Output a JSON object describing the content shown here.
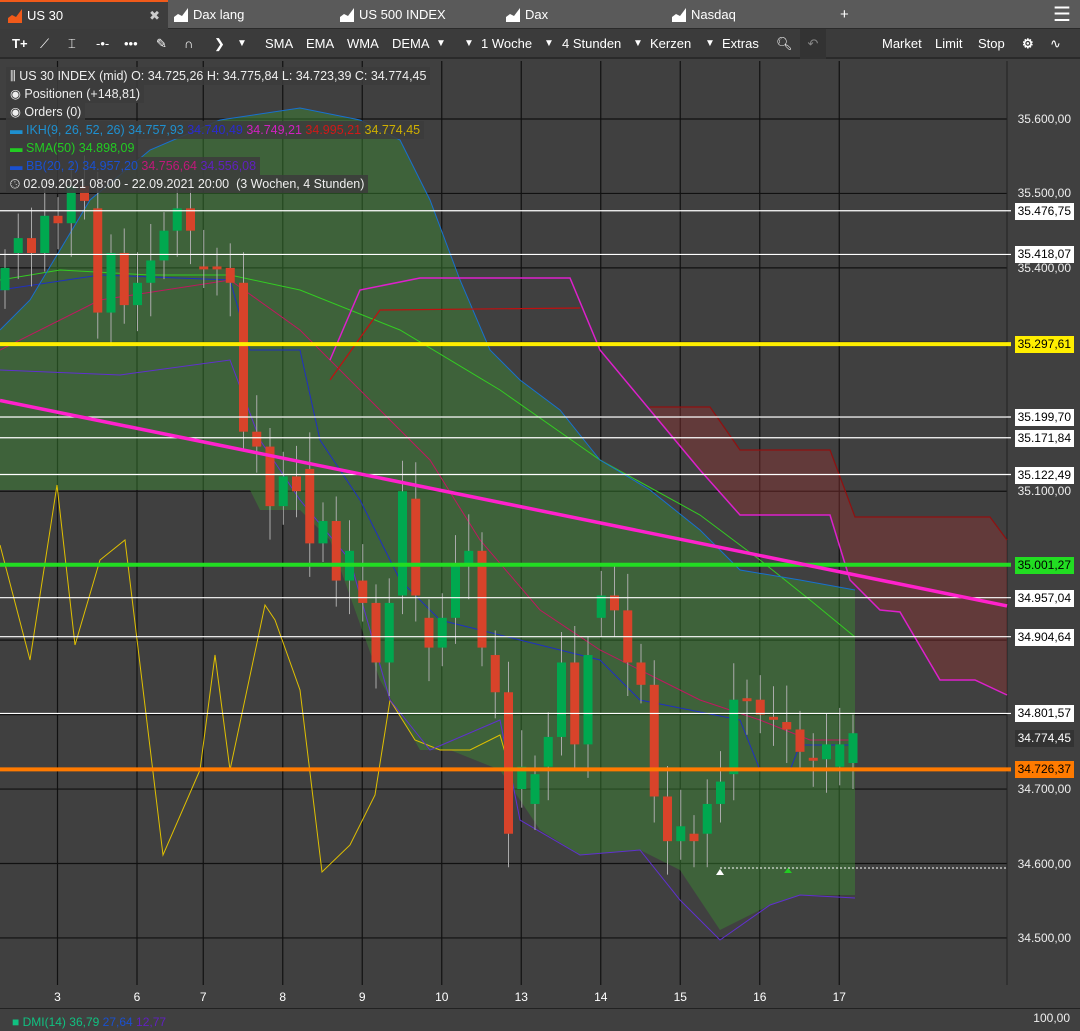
{
  "tabs": [
    {
      "label": "US 30",
      "active": true
    },
    {
      "label": "Dax lang"
    },
    {
      "label": "US 500 INDEX"
    },
    {
      "label": "Dax"
    },
    {
      "label": "Nasdaq"
    }
  ],
  "tabs_add": "+",
  "toolbar": {
    "tools": [
      "text-tool",
      "line-tool",
      "fib-tool",
      "hline-tool",
      "channel-tool",
      "pencil-tool",
      "arc-tool",
      "arrow-tool"
    ],
    "sma": "SMA",
    "ema": "EMA",
    "wma": "WMA",
    "dema": "DEMA",
    "period": "1 Woche",
    "interval": "4 Stunden",
    "chart_type": "Kerzen",
    "extras": "Extras",
    "market": "Market",
    "limit": "Limit",
    "stop": "Stop"
  },
  "legend": {
    "instrument": "US 30 INDEX (mid)",
    "ohlc": "O: 34.725,26  H: 34.775,84  L: 34.723,39  C: 34.774,45",
    "positions": "Positionen (+148,81)",
    "orders": "Orders (0)",
    "ikh": {
      "label": "IKH(9, 26, 52, 26)",
      "v1": "34.757,93",
      "v2": "34.740,49",
      "v3": "34.749,21",
      "v4": "34.995,21",
      "v5": "34.774,45"
    },
    "sma": {
      "label": "SMA(50)",
      "v1": "34.898,09"
    },
    "bb": {
      "label": "BB(20, 2)",
      "v1": "34.957,20",
      "v2": "34.756,64",
      "v3": "34.556,08"
    },
    "range": "02.09.2021 08:00 - 22.09.2021 20:00",
    "range_len": "(3 Wochen, 4 Stunden)"
  },
  "colors": {
    "up": "#00a84f",
    "down": "#d8432a",
    "yellow": "#ffee00",
    "green": "#22dd22",
    "orange": "#ff7a00",
    "trend": "#ff22cc"
  },
  "chart_data": {
    "type": "candlestick",
    "ylim": [
      34400,
      35680
    ],
    "y_ticks": [
      "35.600,00",
      "35.500,00",
      "35.400,00",
      "35.100,00",
      "34.700,00",
      "34.600,00",
      "34.500,00"
    ],
    "y_tick_values": [
      35600,
      35500,
      35400,
      35100,
      34700,
      34600,
      34500
    ],
    "x_ticks": [
      "3",
      "6",
      "7",
      "8",
      "9",
      "10",
      "13",
      "14",
      "15",
      "16",
      "17"
    ],
    "x_tick_index": [
      4,
      10,
      15,
      21,
      27,
      33,
      39,
      45,
      51,
      57,
      63
    ],
    "price_lines": [
      {
        "label": "35.476,75",
        "value": 35476.75,
        "kind": "white"
      },
      {
        "label": "35.418,07",
        "value": 35418.07,
        "kind": "white"
      },
      {
        "label": "35.297,61",
        "value": 35297.61,
        "kind": "yellow"
      },
      {
        "label": "35.199,70",
        "value": 35199.7,
        "kind": "white"
      },
      {
        "label": "35.171,84",
        "value": 35171.84,
        "kind": "white"
      },
      {
        "label": "35.122,49",
        "value": 35122.49,
        "kind": "white"
      },
      {
        "label": "35.001,27",
        "value": 35001.27,
        "kind": "green"
      },
      {
        "label": "34.957,04",
        "value": 34957.04,
        "kind": "white"
      },
      {
        "label": "34.904,64",
        "value": 34904.64,
        "kind": "white"
      },
      {
        "label": "34.801,57",
        "value": 34801.57,
        "kind": "white"
      },
      {
        "label": "34.726,37",
        "value": 34726.37,
        "kind": "orange"
      }
    ],
    "current_price": {
      "label": "34.774,45",
      "value": 34774.45
    },
    "trendline": {
      "from": 35222,
      "to": 34946
    },
    "candles": [
      [
        35370,
        35400
      ],
      [
        35420,
        35440
      ],
      [
        35440,
        35420
      ],
      [
        35420,
        35470
      ],
      [
        35470,
        35460
      ],
      [
        35460,
        35510
      ],
      [
        35510,
        35490
      ],
      [
        35480,
        35340
      ],
      [
        35340,
        35420
      ],
      [
        35420,
        35350
      ],
      [
        35350,
        35380
      ],
      [
        35380,
        35410
      ],
      [
        35410,
        35450
      ],
      [
        35450,
        35480
      ],
      [
        35480,
        35450
      ],
      [
        35402,
        35398
      ],
      [
        35402,
        35398
      ],
      [
        35400,
        35380
      ],
      [
        35380,
        35180
      ],
      [
        35180,
        35160
      ],
      [
        35160,
        35080
      ],
      [
        35080,
        35120
      ],
      [
        35120,
        35100
      ],
      [
        35130,
        35030
      ],
      [
        35030,
        35060
      ],
      [
        35060,
        34980
      ],
      [
        34980,
        35020
      ],
      [
        34980,
        34950
      ],
      [
        34950,
        34870
      ],
      [
        34870,
        34950
      ],
      [
        34960,
        35100
      ],
      [
        35090,
        34960
      ],
      [
        34930,
        34890
      ],
      [
        34890,
        34930
      ],
      [
        34930,
        35000
      ],
      [
        35000,
        35020
      ],
      [
        35020,
        34890
      ],
      [
        34880,
        34830
      ],
      [
        34830,
        34640
      ],
      [
        34700,
        34730
      ],
      [
        34680,
        34720
      ],
      [
        34730,
        34770
      ],
      [
        34770,
        34870
      ],
      [
        34870,
        34760
      ],
      [
        34760,
        34880
      ],
      [
        34930,
        34960
      ],
      [
        34960,
        34940
      ],
      [
        34940,
        34870
      ],
      [
        34870,
        34840
      ],
      [
        34840,
        34690
      ],
      [
        34690,
        34630
      ],
      [
        34630,
        34650
      ],
      [
        34640,
        34630
      ],
      [
        34640,
        34680
      ],
      [
        34680,
        34710
      ],
      [
        34720,
        34820
      ],
      [
        34822,
        34818
      ],
      [
        34820,
        34800
      ],
      [
        34797,
        34793
      ],
      [
        34790,
        34780
      ],
      [
        34780,
        34750
      ],
      [
        34742,
        34738
      ],
      [
        34740,
        34760
      ],
      [
        34730,
        34760
      ],
      [
        34735,
        34775
      ]
    ]
  },
  "dmi": {
    "label": "DMI(14)",
    "v1": "36,79",
    "v2": "27,64",
    "v3": "12,77",
    "axis": "100,00"
  }
}
